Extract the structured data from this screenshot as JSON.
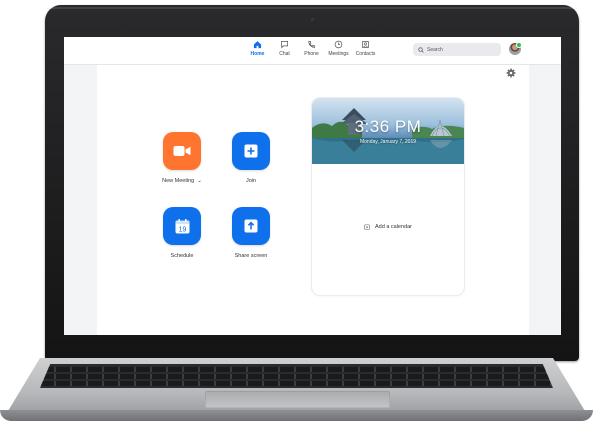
{
  "nav": {
    "items": [
      {
        "label": "Home",
        "icon": "home-icon",
        "active": true
      },
      {
        "label": "Chat",
        "icon": "chat-icon"
      },
      {
        "label": "Phone",
        "icon": "phone-icon"
      },
      {
        "label": "Meetings",
        "icon": "clock-icon"
      },
      {
        "label": "Contacts",
        "icon": "contacts-icon"
      }
    ]
  },
  "search": {
    "placeholder": "Search"
  },
  "actions": {
    "new_meeting": {
      "label": "New Meeting",
      "chevron": "⌄",
      "icon": "video-camera-icon"
    },
    "join": {
      "label": "Join",
      "icon": "plus-icon"
    },
    "schedule": {
      "label": "Schedule",
      "day": "19",
      "icon": "calendar-icon"
    },
    "share_screen": {
      "label": "Share screen",
      "icon": "share-arrow-icon"
    }
  },
  "calendar": {
    "time": "3:36 PM",
    "date": "Monday, January 7, 2019",
    "add_label": "Add a calendar"
  },
  "colors": {
    "accent_blue": "#0e71eb",
    "orange": "#ff742e",
    "presence_green": "#23c552"
  }
}
